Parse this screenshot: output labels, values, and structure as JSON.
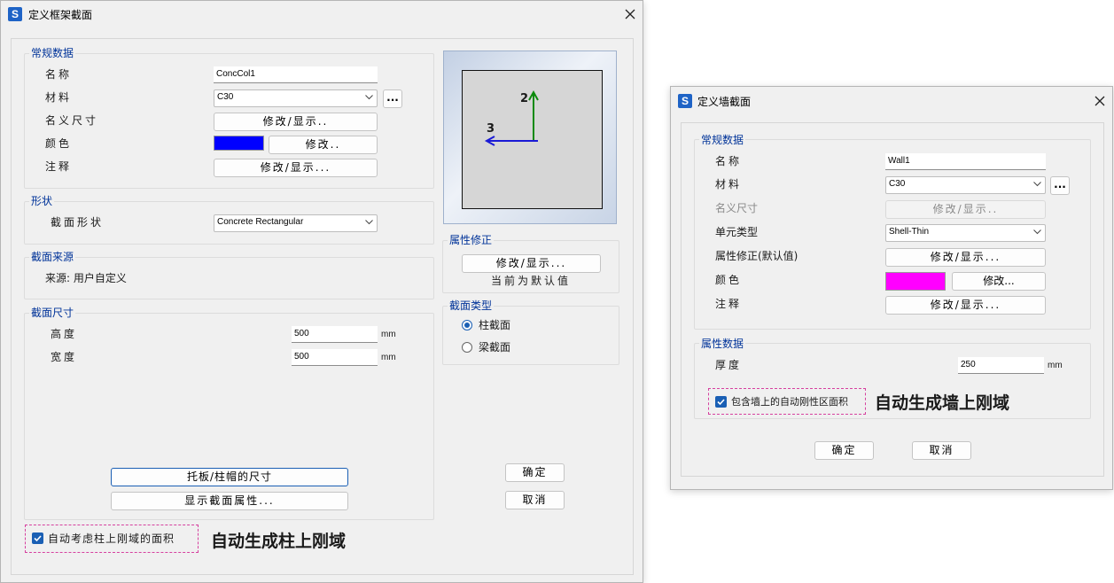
{
  "frame_dialog": {
    "title": "定义框架截面",
    "general_group": "常规数据",
    "name_label": "名称",
    "name_value": "ConcCol1",
    "material_label": "材料",
    "material_value": "C30",
    "material_more": "...",
    "nominal_label": "名义尺寸",
    "nominal_btn": "修改/显示..",
    "color_label": "颜色",
    "color_value": "#0000ff",
    "color_btn": "修改..",
    "notes_label": "注释",
    "notes_btn": "修改/显示...",
    "shape_group": "形状",
    "shape_label": "截面形状",
    "shape_value": "Concrete Rectangular",
    "source_group": "截面来源",
    "source_text": "来源: 用户自定义",
    "dims_group": "截面尺寸",
    "height_label": "高度",
    "height_value": "500",
    "height_unit": "mm",
    "width_label": "宽度",
    "width_value": "500",
    "width_unit": "mm",
    "drop_panel_btn": "托板/柱帽的尺寸",
    "show_props_btn": "显示截面属性...",
    "preview_axis_2": "2",
    "preview_axis_3": "3",
    "modifiers_group": "属性修正",
    "modifiers_btn": "修改/显示...",
    "modifiers_status": "当前为默认值",
    "section_type_group": "截面类型",
    "type_column": "柱截面",
    "type_beam": "梁截面",
    "ok_btn": "确定",
    "cancel_btn": "取消",
    "auto_rigid_checkbox": "自动考虑柱上刚域的面积",
    "annotation": "自动生成柱上刚域"
  },
  "wall_dialog": {
    "title": "定义墙截面",
    "general_group": "常规数据",
    "name_label": "名称",
    "name_value": "Wall1",
    "material_label": "材料",
    "material_value": "C30",
    "material_more": "...",
    "nominal_label": "名义尺寸",
    "nominal_btn": "修改/显示..",
    "element_type_label": "单元类型",
    "element_type_value": "Shell-Thin",
    "modifiers_label": "属性修正(默认值)",
    "modifiers_btn": "修改/显示...",
    "color_label": "颜色",
    "color_value": "#ff00ff",
    "color_btn": "修改...",
    "notes_label": "注释",
    "notes_btn": "修改/显示...",
    "prop_group": "属性数据",
    "thickness_label": "厚度",
    "thickness_value": "250",
    "thickness_unit": "mm",
    "auto_rigid_checkbox": "包含墙上的自动刚性区面积",
    "ok_btn": "确定",
    "cancel_btn": "取消",
    "annotation": "自动生成墙上刚域"
  }
}
